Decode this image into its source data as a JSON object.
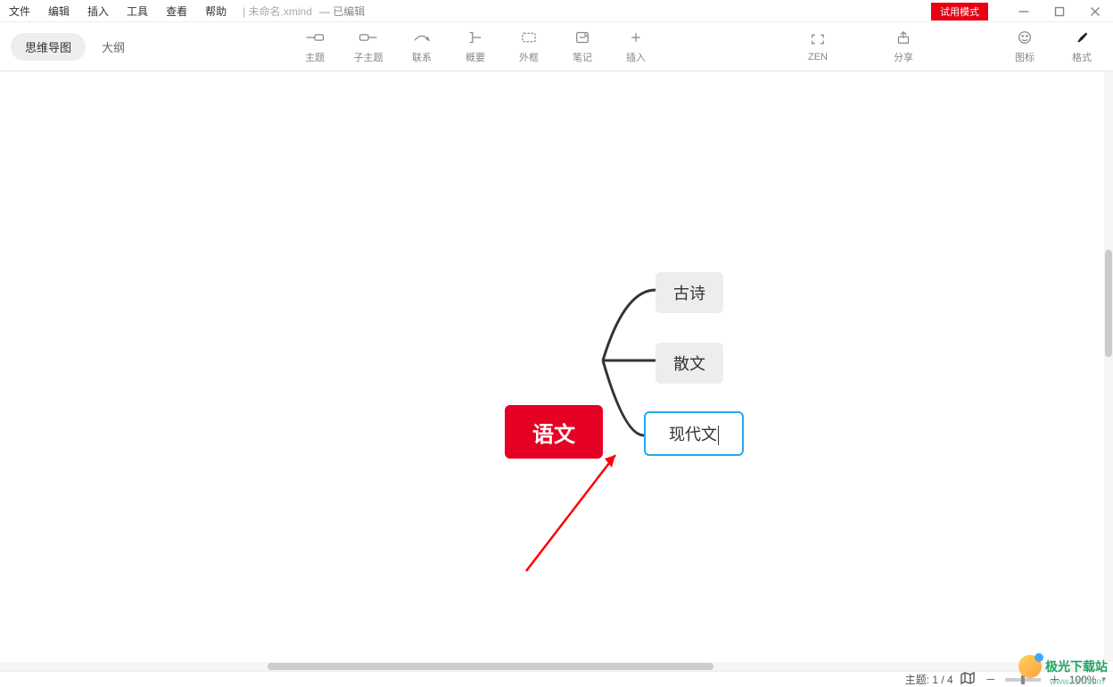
{
  "menubar": {
    "items": [
      "文件",
      "编辑",
      "插入",
      "工具",
      "查看",
      "帮助"
    ]
  },
  "title": {
    "filename": "未命名.xmind",
    "status": "— 已编辑"
  },
  "trial_label": "试用模式",
  "viewTabs": {
    "mindmap": "思维导图",
    "outline": "大纲"
  },
  "tools": {
    "topic": "主题",
    "subtopic": "子主题",
    "relation": "联系",
    "summary": "概要",
    "boundary": "外框",
    "note": "笔记",
    "insert": "插入"
  },
  "rightTools": {
    "zen": "ZEN",
    "share": "分享",
    "icons": "图标",
    "format": "格式"
  },
  "mindmap": {
    "central": "语文",
    "children": [
      "古诗",
      "散文",
      "现代文"
    ],
    "selected_index": 2
  },
  "statusbar": {
    "topic_label": "主题:",
    "topic_value": "1 / 4",
    "zoom": "100%"
  },
  "watermark": {
    "text": "极光下载站",
    "sub": "www.xz7.com"
  }
}
